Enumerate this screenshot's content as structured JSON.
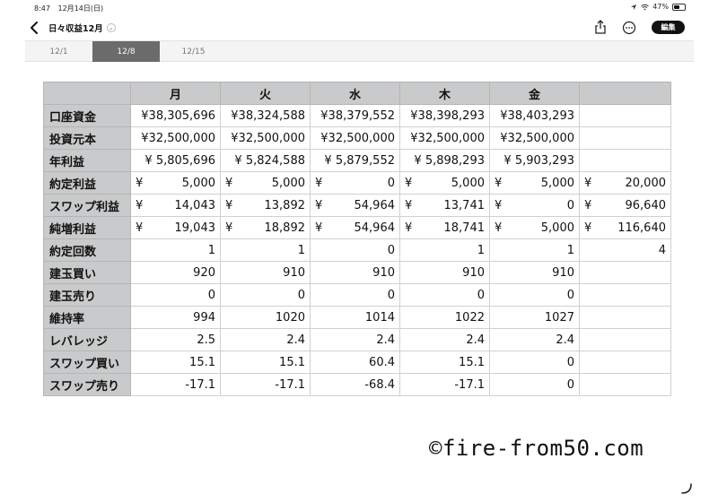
{
  "status_bar": {
    "time": "8:47",
    "date": "12月14日(日)",
    "battery_text": "47%",
    "battery_level": 0.47
  },
  "header": {
    "title": "日々収益12月",
    "edit_label": "編集"
  },
  "tabs": [
    {
      "label": "12/1",
      "active": false
    },
    {
      "label": "12/8",
      "active": true
    },
    {
      "label": "12/15",
      "active": false
    }
  ],
  "table": {
    "columns": [
      "",
      "月",
      "火",
      "水",
      "木",
      "金",
      ""
    ],
    "rows": [
      {
        "label": "口座資金",
        "cells": [
          "¥38,305,696",
          "¥38,324,588",
          "¥38,379,552",
          "¥38,398,293",
          "¥38,403,293",
          ""
        ]
      },
      {
        "label": "投資元本",
        "cells": [
          "¥32,500,000",
          "¥32,500,000",
          "¥32,500,000",
          "¥32,500,000",
          "¥32,500,000",
          ""
        ]
      },
      {
        "label": "年利益",
        "cells": [
          "¥  5,805,696",
          "¥  5,824,588",
          "¥  5,879,552",
          "¥  5,898,293",
          "¥  5,903,293",
          ""
        ]
      },
      {
        "label": "約定利益",
        "cells": [
          "5,000",
          "5,000",
          "0",
          "5,000",
          "5,000",
          "20,000"
        ],
        "yen": true
      },
      {
        "label": "スワップ利益",
        "cells": [
          "14,043",
          "13,892",
          "54,964",
          "13,741",
          "0",
          "96,640"
        ],
        "yen": true
      },
      {
        "label": "純増利益",
        "cells": [
          "19,043",
          "18,892",
          "54,964",
          "18,741",
          "5,000",
          "116,640"
        ],
        "yen": true
      },
      {
        "label": "約定回数",
        "cells": [
          "1",
          "1",
          "0",
          "1",
          "1",
          "4"
        ]
      },
      {
        "label": "建玉買い",
        "cells": [
          "920",
          "910",
          "910",
          "910",
          "910",
          ""
        ]
      },
      {
        "label": "建玉売り",
        "cells": [
          "0",
          "0",
          "0",
          "0",
          "0",
          ""
        ]
      },
      {
        "label": "維持率",
        "cells": [
          "994",
          "1020",
          "1014",
          "1022",
          "1027",
          ""
        ]
      },
      {
        "label": "レバレッジ",
        "cells": [
          "2.5",
          "2.4",
          "2.4",
          "2.4",
          "2.4",
          ""
        ]
      },
      {
        "label": "スワップ買い",
        "cells": [
          "15.1",
          "15.1",
          "60.4",
          "15.1",
          "0",
          ""
        ]
      },
      {
        "label": "スワップ売り",
        "cells": [
          "-17.1",
          "-17.1",
          "-68.4",
          "-17.1",
          "0",
          ""
        ]
      }
    ]
  },
  "yen_symbol": "¥",
  "watermark": "©fire-from50.com",
  "colors": {
    "header_gray": "#c9cacb",
    "active_tab": "#6b6b6b",
    "edit_button": "#111111"
  },
  "icons": [
    "back-chevron-icon",
    "share-icon",
    "more-icon",
    "wifi-icon",
    "location-icon",
    "battery-icon"
  ]
}
